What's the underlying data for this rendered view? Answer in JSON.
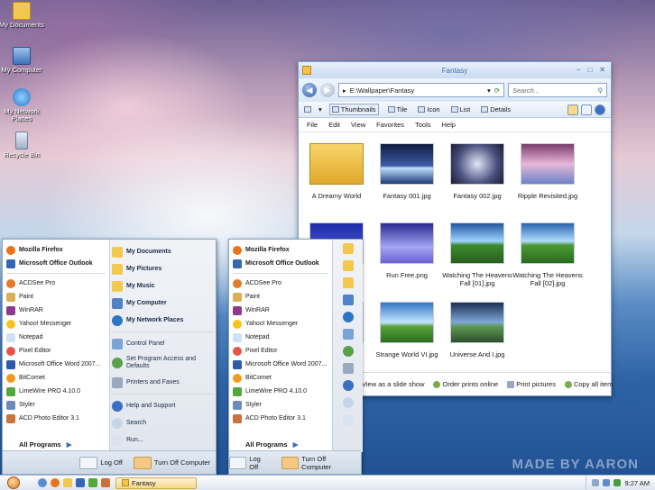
{
  "desktop": {
    "icons": [
      {
        "label": "My Documents",
        "icon": "folder-documents-icon"
      },
      {
        "label": "My Computer",
        "icon": "computer-icon"
      },
      {
        "label": "My Network Places",
        "icon": "network-icon"
      },
      {
        "label": "Recycle Bin",
        "icon": "recycle-bin-icon"
      }
    ],
    "watermark": "MADE BY AARON"
  },
  "explorer": {
    "title": "Fantasy",
    "address": "E:\\Wallpaper\\Fantasy",
    "search_placeholder": "Search...",
    "views": [
      "Thumbnails",
      "Tile",
      "Icon",
      "List",
      "Details"
    ],
    "menu": [
      "File",
      "Edit",
      "View",
      "Favorites",
      "Tools",
      "Help"
    ],
    "items": [
      {
        "label": "A Dreamy World",
        "type": "folder"
      },
      {
        "label": "Fantasy 001.jpg"
      },
      {
        "label": "Fantasy 002.jpg"
      },
      {
        "label": "Ripple Revisited.jpg"
      },
      {
        "label": ""
      },
      {
        "label": "Run Free.png"
      },
      {
        "label": "Watching The  Heavens Fall [01].jpg"
      },
      {
        "label": "Watching The  Heavens Fall [02].jpg"
      },
      {
        "label": ""
      },
      {
        "label": "Strange World VI.jpg"
      },
      {
        "label": "Universe And I.jpg"
      }
    ],
    "status": [
      "View as a slide show",
      "Order prints online",
      "Print pictures",
      "Copy all item"
    ]
  },
  "startmenu": {
    "pinned": [
      "Mozilla Firefox",
      "Microsoft Office Outlook"
    ],
    "recent": [
      "ACDSee Pro",
      "Paint",
      "WinRAR",
      "Yahoo! Messenger",
      "Notepad",
      "Pixel Editor",
      "Microsoft Office Word 2007...",
      "BitComet",
      "LimeWire PRO 4.10.0",
      "Styler",
      "ACD Photo Editor 3.1"
    ],
    "all_programs": "All Programs",
    "right_top": [
      "My Documents",
      "My Pictures",
      "My Music",
      "My Computer",
      "My Network Places"
    ],
    "right_mid": [
      "Control Panel",
      "Set Program Access and Defaults",
      "Printers and Faxes"
    ],
    "right_bottom": [
      "Help and Support",
      "Search",
      "Run..."
    ],
    "log_off": "Log Off",
    "turn_off": "Turn Off Computer"
  },
  "taskbar": {
    "task": "Fantasy",
    "clock": "9:27 AM"
  }
}
